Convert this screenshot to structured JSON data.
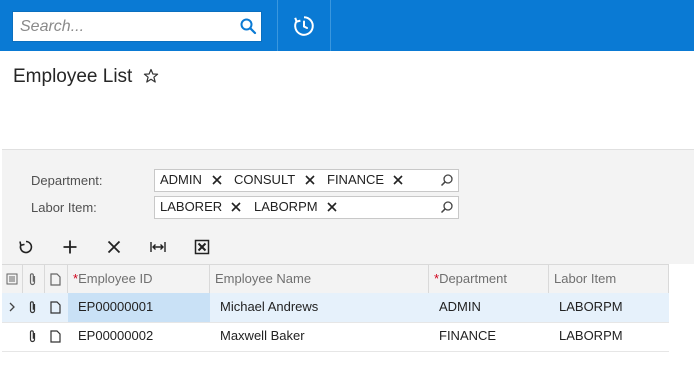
{
  "search": {
    "placeholder": "Search..."
  },
  "icons": {
    "search": "search-icon",
    "history": "history-icon",
    "favorite": "star-icon"
  },
  "page": {
    "title": "Employee List"
  },
  "filters": {
    "department": {
      "label": "Department:",
      "chips": [
        "ADMIN",
        "CONSULT",
        "FINANCE"
      ]
    },
    "labor_item": {
      "label": "Labor Item:",
      "chips": [
        "LABORER",
        "LABORPM"
      ]
    }
  },
  "toolbar": {
    "buttons": [
      "refresh",
      "add",
      "delete",
      "fit-columns",
      "export-excel"
    ]
  },
  "grid": {
    "columns": [
      {
        "label": "Employee ID",
        "required": true
      },
      {
        "label": "Employee Name",
        "required": false
      },
      {
        "label": "Department",
        "required": true
      },
      {
        "label": "Labor Item",
        "required": false
      }
    ],
    "required_marker": "*",
    "rows": [
      {
        "employee_id": "EP00000001",
        "employee_name": "Michael Andrews",
        "department": "ADMIN",
        "labor_item": "LABORPM",
        "selected": true
      },
      {
        "employee_id": "EP00000002",
        "employee_name": "Maxwell Baker",
        "department": "FINANCE",
        "labor_item": "LABORPM",
        "selected": false
      }
    ]
  },
  "colors": {
    "topbar": "#0a7ad4",
    "selected_row": "#e6f1fb",
    "active_cell": "#c9e1f6",
    "required": "#d0021b"
  }
}
